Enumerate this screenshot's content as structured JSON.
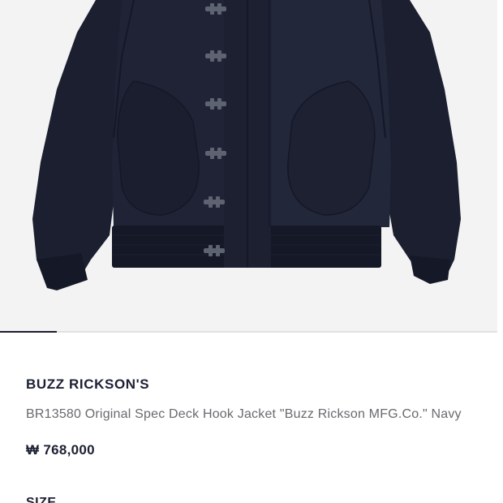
{
  "product_image": {
    "subject": "navy deck hook jacket",
    "colors": {
      "background": "#f3f3f4",
      "jacket": "#1e2233",
      "jacket_shadow": "#161a28",
      "jacket_highlight": "#2a2f44",
      "rib": "#151826",
      "hardware": "#7d8290"
    }
  },
  "carousel": {
    "progress": 0.115,
    "colors": {
      "track": "#e2e2e4",
      "fill": "#1a1c2e"
    }
  },
  "product": {
    "brand": "BUZZ RICKSON'S",
    "title": "BR13580 Original Spec Deck Hook Jacket \"Buzz Rickson MFG.Co.\" Navy",
    "price": "₩ 768,000",
    "size_label": "SIZE"
  }
}
